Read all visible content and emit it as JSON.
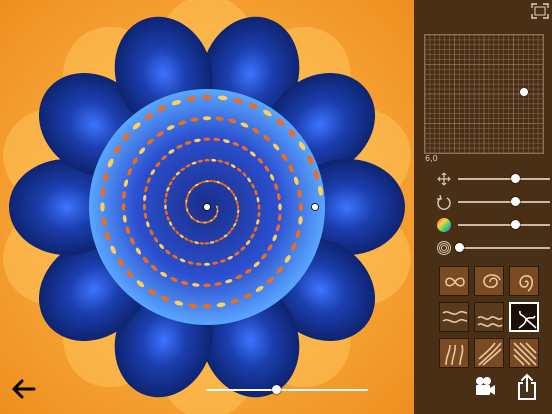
{
  "canvas": {
    "bg_color": "#f39a2a",
    "petal_color": "#1a3a9c",
    "inner_color": "#2a55d6",
    "accent_color": "#ffb347",
    "petal_count": 10
  },
  "panel": {
    "bg_color": "#4a2f17",
    "coordinate_text": "6,0",
    "sliders": [
      {
        "icon": "move-arrows-icon",
        "value": 0.64
      },
      {
        "icon": "rotate-icon",
        "value": 0.64
      },
      {
        "icon": "color-wheel-icon",
        "value": 0.64
      },
      {
        "icon": "spiral-icon",
        "value": 0.0
      }
    ],
    "pattern_thumbs": [
      {
        "name": "thumb-infinity",
        "selected": false
      },
      {
        "name": "thumb-swirl",
        "selected": false
      },
      {
        "name": "thumb-vortex",
        "selected": false
      },
      {
        "name": "thumb-waves",
        "selected": false
      },
      {
        "name": "thumb-ripple",
        "selected": false
      },
      {
        "name": "thumb-tentacle",
        "selected": true
      },
      {
        "name": "thumb-coral",
        "selected": false
      },
      {
        "name": "thumb-feather",
        "selected": false
      },
      {
        "name": "thumb-stripes",
        "selected": false
      }
    ]
  },
  "controls": {
    "back_icon": "back-arrow-icon",
    "record_icon": "video-camera-icon",
    "share_icon": "share-icon",
    "fullscreen_icon": "fullscreen-icon",
    "timeline_value": 0.43
  }
}
